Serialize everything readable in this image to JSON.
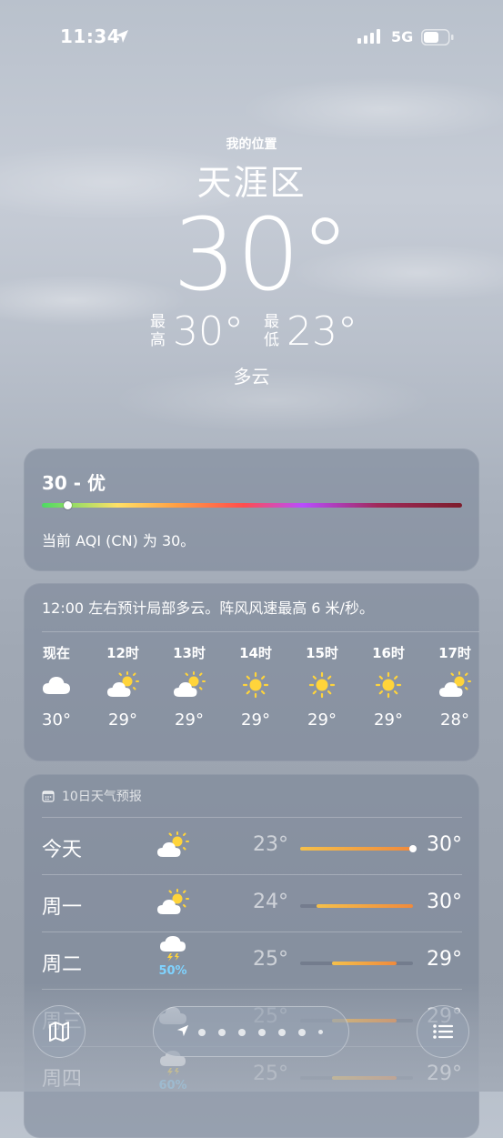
{
  "status": {
    "time": "11:34",
    "network": "5G"
  },
  "header": {
    "my_location": "我的位置",
    "city": "天涯区",
    "temperature": "30°",
    "high_label": "最高",
    "high": "30°",
    "low_label": "最低",
    "low": "23°",
    "condition": "多云"
  },
  "aqi": {
    "title": "30 - 优",
    "description": "当前 AQI (CN) 为 30。",
    "value_fraction": 0.06
  },
  "hourly": {
    "summary": "12:00 左右预计局部多云。阵风风速最高 6 米/秒。",
    "items": [
      {
        "label": "现在",
        "icon": "cloud-icon",
        "temp": "30°"
      },
      {
        "label": "12时",
        "icon": "partly-sunny-icon",
        "temp": "29°"
      },
      {
        "label": "13时",
        "icon": "partly-sunny-icon",
        "temp": "29°"
      },
      {
        "label": "14时",
        "icon": "sun-icon",
        "temp": "29°"
      },
      {
        "label": "15时",
        "icon": "sun-icon",
        "temp": "29°"
      },
      {
        "label": "16时",
        "icon": "sun-icon",
        "temp": "29°"
      },
      {
        "label": "17时",
        "icon": "partly-sunny-icon",
        "temp": "28°"
      }
    ]
  },
  "daily": {
    "title": "10日天气预报",
    "range_min": 23,
    "range_max": 30,
    "days": [
      {
        "name": "今天",
        "icon": "partly-sunny-icon",
        "low": "23°",
        "high": "30°",
        "low_v": 23,
        "high_v": 30,
        "current_v": 30,
        "pop": ""
      },
      {
        "name": "周一",
        "icon": "partly-sunny-icon",
        "low": "24°",
        "high": "30°",
        "low_v": 24,
        "high_v": 30,
        "pop": ""
      },
      {
        "name": "周二",
        "icon": "thunderstorm-icon",
        "low": "25°",
        "high": "29°",
        "low_v": 25,
        "high_v": 29,
        "pop": "50%"
      },
      {
        "name": "周三",
        "icon": "cloud-icon",
        "low": "25°",
        "high": "29°",
        "low_v": 25,
        "high_v": 29,
        "pop": ""
      },
      {
        "name": "周四",
        "icon": "thunderstorm-icon",
        "low": "25°",
        "high": "29°",
        "low_v": 25,
        "high_v": 29,
        "pop": "60%"
      }
    ]
  },
  "pager": {
    "page_count": 7,
    "active_index": 0
  }
}
